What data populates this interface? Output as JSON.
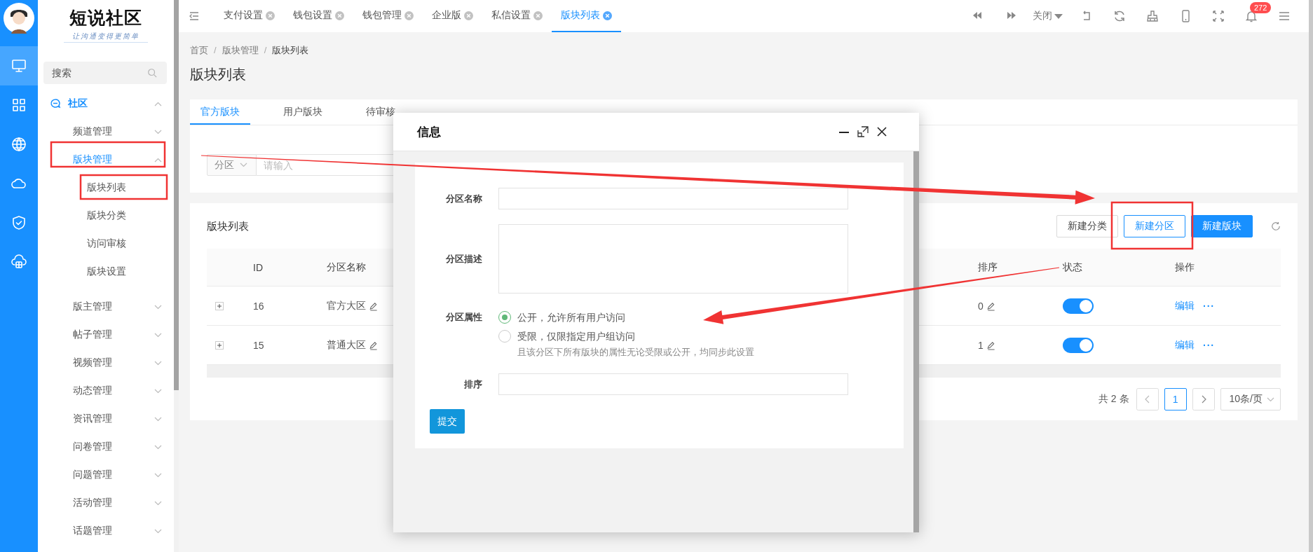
{
  "rail": {
    "items": [
      {
        "selected": true
      },
      {
        "selected": false
      },
      {
        "selected": false
      },
      {
        "selected": false
      },
      {
        "selected": false
      },
      {
        "selected": false
      }
    ]
  },
  "sidebar": {
    "logo": {
      "title": "短说社区",
      "slogan": "让沟通变得更简单"
    },
    "search": {
      "placeholder": "搜索"
    },
    "menu": [
      {
        "label": "社区",
        "expanded": true,
        "active": true,
        "children": [
          {
            "label": "频道管理",
            "expanded": false,
            "active": false
          },
          {
            "label": "版块管理",
            "expanded": true,
            "active": true,
            "children": [
              {
                "label": "版块列表"
              },
              {
                "label": "版块分类"
              },
              {
                "label": "访问审核"
              },
              {
                "label": "版块设置"
              }
            ]
          },
          {
            "label": "版主管理",
            "expanded": false,
            "active": false
          },
          {
            "label": "帖子管理",
            "expanded": false,
            "active": false
          },
          {
            "label": "视频管理",
            "expanded": false,
            "active": false
          },
          {
            "label": "动态管理",
            "expanded": false,
            "active": false
          },
          {
            "label": "资讯管理",
            "expanded": false,
            "active": false
          },
          {
            "label": "问卷管理",
            "expanded": false,
            "active": false
          },
          {
            "label": "问题管理",
            "expanded": false,
            "active": false
          },
          {
            "label": "活动管理",
            "expanded": false,
            "active": false
          },
          {
            "label": "话题管理",
            "expanded": false,
            "active": false
          }
        ]
      }
    ]
  },
  "top_bar": {
    "tabs": [
      {
        "label": "支付设置",
        "selected": false
      },
      {
        "label": "钱包设置",
        "selected": false
      },
      {
        "label": "钱包管理",
        "selected": false
      },
      {
        "label": "企业版",
        "selected": false
      },
      {
        "label": "私信设置",
        "selected": false
      },
      {
        "label": "版块列表",
        "selected": true
      }
    ],
    "tools": [
      {
        "kind": "back"
      },
      {
        "kind": "forward"
      },
      {
        "kind": "dropdown",
        "label": "关闭"
      },
      {
        "kind": "return"
      },
      {
        "kind": "refresh"
      },
      {
        "kind": "broom"
      },
      {
        "kind": "phone"
      },
      {
        "kind": "fullscreen"
      },
      {
        "kind": "bell",
        "badge": "272"
      },
      {
        "kind": "menu"
      }
    ]
  },
  "breadcrumb": {
    "items": [
      "首页",
      "版块管理",
      "版块列表"
    ],
    "separator": "/"
  },
  "page_title": "版块列表",
  "content_tabs": [
    {
      "label": "官方版块",
      "selected": true
    },
    {
      "label": "用户版块",
      "selected": false
    },
    {
      "label": "待审核",
      "selected": false
    }
  ],
  "filter": {
    "select": "分区",
    "placeholder": "请输入"
  },
  "list_card": {
    "title": "版块列表",
    "buttons": [
      {
        "label": "新建分类",
        "kind": "default"
      },
      {
        "label": "新建分区",
        "kind": "outline"
      },
      {
        "label": "新建版块",
        "kind": "primary"
      }
    ],
    "table": {
      "columns": [
        "ID",
        "分区名称",
        "排序",
        "状态",
        "操作"
      ],
      "rows": [
        {
          "id": "16",
          "name": "官方大区",
          "sort": "0",
          "on": true,
          "actions": [
            "编辑",
            "···"
          ]
        },
        {
          "id": "15",
          "name": "普通大区",
          "sort": "1",
          "on": true,
          "actions": [
            "编辑",
            "···"
          ]
        }
      ]
    },
    "pagination": {
      "total": "共 2 条",
      "pages": [
        {
          "label": "1",
          "selected": true
        }
      ],
      "page_size": "10条/页"
    }
  },
  "dialog": {
    "title": "信息",
    "fields": [
      {
        "kind": "input",
        "label": "分区名称"
      },
      {
        "kind": "textarea",
        "label": "分区描述"
      },
      {
        "kind": "radio",
        "label": "分区属性",
        "options": [
          {
            "label": "公开，允许所有用户访问",
            "selected": true
          },
          {
            "label": "受限，仅限指定用户组访问",
            "selected": false
          }
        ],
        "hint": "且该分区下所有版块的属性无论受限或公开，均同步此设置"
      },
      {
        "kind": "input",
        "label": "排序"
      }
    ],
    "submit": "提交"
  },
  "annotations": [
    {
      "kind": "frame"
    },
    {
      "kind": "frame"
    },
    {
      "kind": "frame"
    },
    {
      "kind": "arrow"
    },
    {
      "kind": "arrow"
    }
  ]
}
